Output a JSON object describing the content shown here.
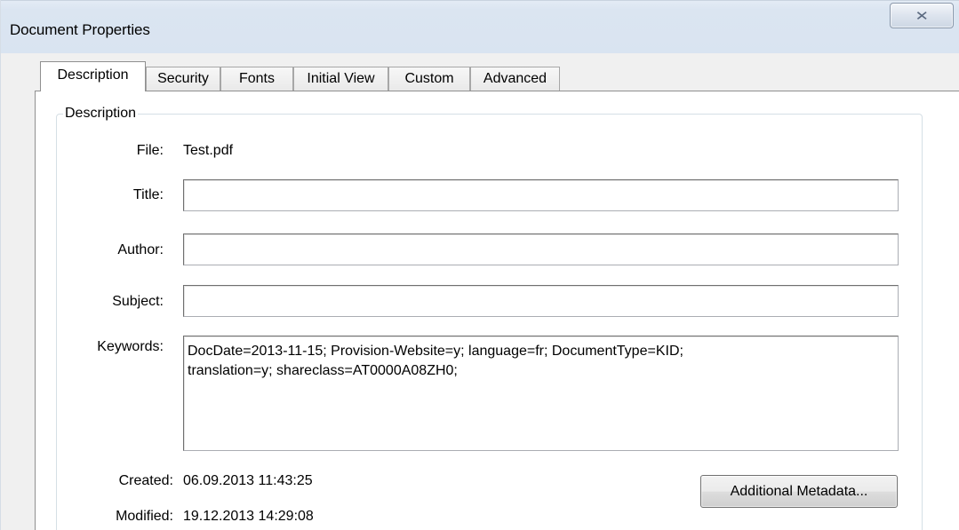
{
  "window": {
    "title": "Document Properties",
    "close_glyph": "✕"
  },
  "tabs": [
    {
      "label": "Description",
      "active": true
    },
    {
      "label": "Security",
      "active": false
    },
    {
      "label": "Fonts",
      "active": false
    },
    {
      "label": "Initial View",
      "active": false
    },
    {
      "label": "Custom",
      "active": false
    },
    {
      "label": "Advanced",
      "active": false
    }
  ],
  "description_group": {
    "legend": "Description",
    "file_label": "File:",
    "file_value": "Test.pdf",
    "title_label": "Title:",
    "title_value": "",
    "author_label": "Author:",
    "author_value": "",
    "subject_label": "Subject:",
    "subject_value": "",
    "keywords_label": "Keywords:",
    "keywords_value": "DocDate=2013-11-15; Provision-Website=y; language=fr; DocumentType=KID;\ntranslation=y; shareclass=AT0000A08ZH0;",
    "created_label": "Created:",
    "created_value": "06.09.2013 11:43:25",
    "modified_label": "Modified:",
    "modified_value": "19.12.2013 14:29:08",
    "additional_metadata_label": "Additional Metadata..."
  }
}
